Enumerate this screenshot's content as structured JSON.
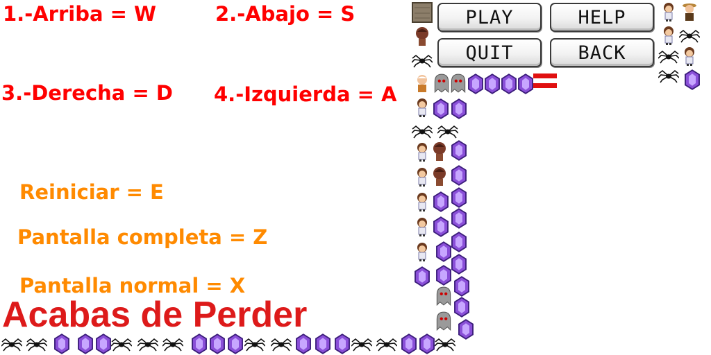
{
  "controls": {
    "up": "1.-Arriba = W",
    "down": "2.-Abajo = S",
    "right": "3.-Derecha = D",
    "left": "4.-Izquierda = A",
    "restart": "Reiniciar = E",
    "fullscreen": "Pantalla completa = Z",
    "normal": "Pantalla normal = X"
  },
  "status": {
    "message": "Acabas de Perder"
  },
  "menu": {
    "play": "PLAY",
    "help": "HELP",
    "quit": "QUIT",
    "back": "BACK"
  },
  "colors": {
    "controls_text": "#ff0000",
    "options_text": "#ff8a00",
    "lose_text": "#dd1a1a",
    "gem": "#8a4fd8"
  },
  "sprites": [
    "stone-block-icon",
    "player-icon",
    "girl-icon",
    "spider-icon",
    "ghost-icon",
    "gem-icon",
    "old-man-icon",
    "explorer-icon",
    "flag-icon"
  ]
}
